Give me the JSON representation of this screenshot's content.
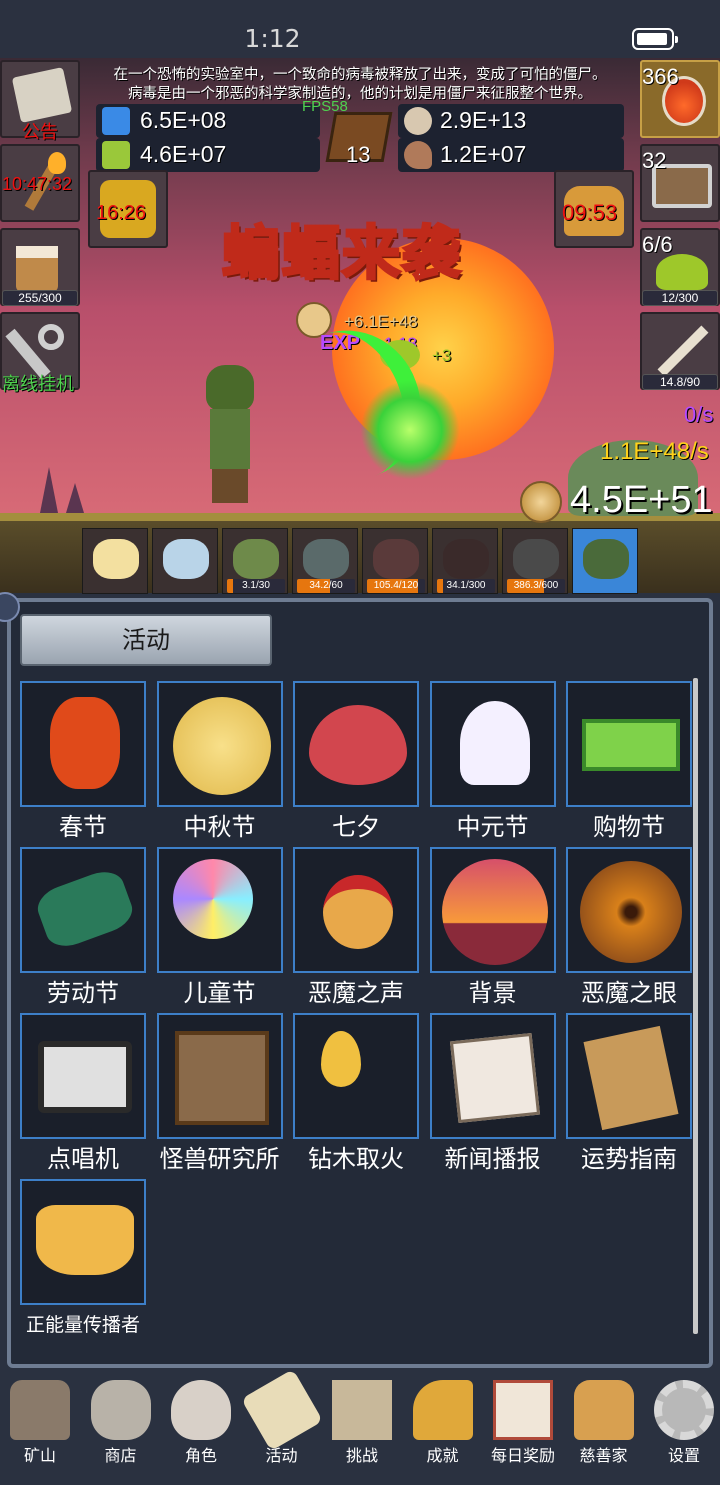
{
  "status_bar": {
    "time": "1:12"
  },
  "scene": {
    "story_line_1": "在一个恐怖的实验室中，一个致命的病毒被释放了出来，变成了可怕的僵尸。",
    "story_line_2": "病毒是由一个邪恶的科学家制造的，他的计划是用僵尸来征服整个世界。",
    "fps": "FPS58",
    "book_count": "13",
    "event_title": "蝙蝠来袭",
    "resources": {
      "potion_blue": "6.5E+08",
      "potion_green": "4.6E+07",
      "coins_silver": "2.9E+13",
      "meat": "1.2E+07"
    },
    "left_buttons": [
      {
        "icon": "scroll-icon",
        "label": "公告"
      },
      {
        "icon": "torch-icon",
        "label": "10:47:32"
      },
      {
        "icon": "mug-icon",
        "bar": "255/300"
      },
      {
        "icon": "key-icon",
        "label": "离线挂机"
      }
    ],
    "lantern_timer": "16:26",
    "bread_timer": "09:53",
    "right_buttons": [
      {
        "icon": "potion-icon",
        "count": "366"
      },
      {
        "icon": "chest-icon",
        "count": "32"
      },
      {
        "icon": "slime-icon",
        "count": "6/6",
        "bar": "12/300"
      },
      {
        "icon": "sword-icon",
        "bar": "14.8/90"
      }
    ],
    "floating": {
      "gold_gain": "+6.1E+48",
      "exp_label": "EXP",
      "exp_gain": "+1.18",
      "slime_gain": "+3"
    },
    "rate_purple": "0/s",
    "rate_gold": "1.1E+48/s",
    "gold_total": "4.5E+51",
    "monsters": [
      {
        "name": "candle",
        "bar": ""
      },
      {
        "name": "egg",
        "bar": ""
      },
      {
        "name": "slime",
        "bar": "3.1/30",
        "fill": 0.1
      },
      {
        "name": "zombie",
        "bar": "34.2/60",
        "fill": 0.57
      },
      {
        "name": "bat",
        "bar": "105.4/120",
        "fill": 0.88
      },
      {
        "name": "spider",
        "bar": "34.1/300",
        "fill": 0.11
      },
      {
        "name": "ghoul",
        "bar": "386.3/600",
        "fill": 0.64
      },
      {
        "name": "orc",
        "bar": ""
      }
    ]
  },
  "panel": {
    "tab_label": "活动",
    "items": [
      {
        "label": "春节",
        "icon": "lantern-icon"
      },
      {
        "label": "中秋节",
        "icon": "moon-icon"
      },
      {
        "label": "七夕",
        "icon": "heart-icon"
      },
      {
        "label": "中元节",
        "icon": "ghost-icon"
      },
      {
        "label": "购物节",
        "icon": "money-icon"
      },
      {
        "label": "劳动节",
        "icon": "brush-icon"
      },
      {
        "label": "儿童节",
        "icon": "lollipop-icon"
      },
      {
        "label": "恶魔之声",
        "icon": "bell-icon"
      },
      {
        "label": "背景",
        "icon": "sunset-icon"
      },
      {
        "label": "恶魔之眼",
        "icon": "eye-icon"
      },
      {
        "label": "点唱机",
        "icon": "cassette-icon"
      },
      {
        "label": "怪兽研究所",
        "icon": "lab-icon"
      },
      {
        "label": "钻木取火",
        "icon": "fire-stick-icon"
      },
      {
        "label": "新闻播报",
        "icon": "newspaper-icon"
      },
      {
        "label": "运势指南",
        "icon": "fortune-icon"
      },
      {
        "label": "正能量传播者",
        "icon": "crown-icon"
      }
    ]
  },
  "nav": {
    "items": [
      {
        "label": "矿山",
        "icon": "lantern-icon"
      },
      {
        "label": "商店",
        "icon": "stone-icon"
      },
      {
        "label": "角色",
        "icon": "skull-icon"
      },
      {
        "label": "活动",
        "icon": "scroll-icon"
      },
      {
        "label": "挑战",
        "icon": "map-icon"
      },
      {
        "label": "成就",
        "icon": "key-icon"
      },
      {
        "label": "每日奖励",
        "icon": "letter-icon"
      },
      {
        "label": "慈善家",
        "icon": "bread-icon"
      },
      {
        "label": "设置",
        "icon": "gear-icon"
      }
    ]
  },
  "colors": {
    "tile_border": "#3d7fc8",
    "timer_red": "#e11111",
    "offline_green": "#4ed34e",
    "rate_gold": "#ffd21a",
    "rate_purple": "#b74aff"
  }
}
